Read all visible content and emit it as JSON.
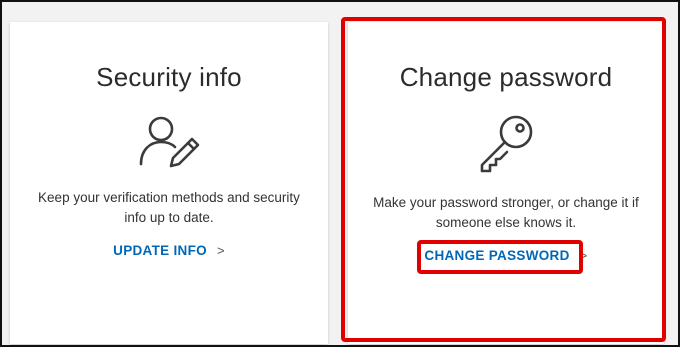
{
  "security_card": {
    "title": "Security info",
    "icon": "user-edit-icon",
    "description": "Keep your verification methods and security info up to date.",
    "link_label": "UPDATE INFO",
    "link_chevron": ">"
  },
  "password_card": {
    "title": "Change password",
    "icon": "key-icon",
    "description": "Make your password stronger, or change it if someone else knows it.",
    "link_label": "CHANGE PASSWORD",
    "link_chevron": ">"
  },
  "colors": {
    "link": "#0067b8",
    "highlight": "#e00000",
    "page_background": "#f2f2f2"
  }
}
